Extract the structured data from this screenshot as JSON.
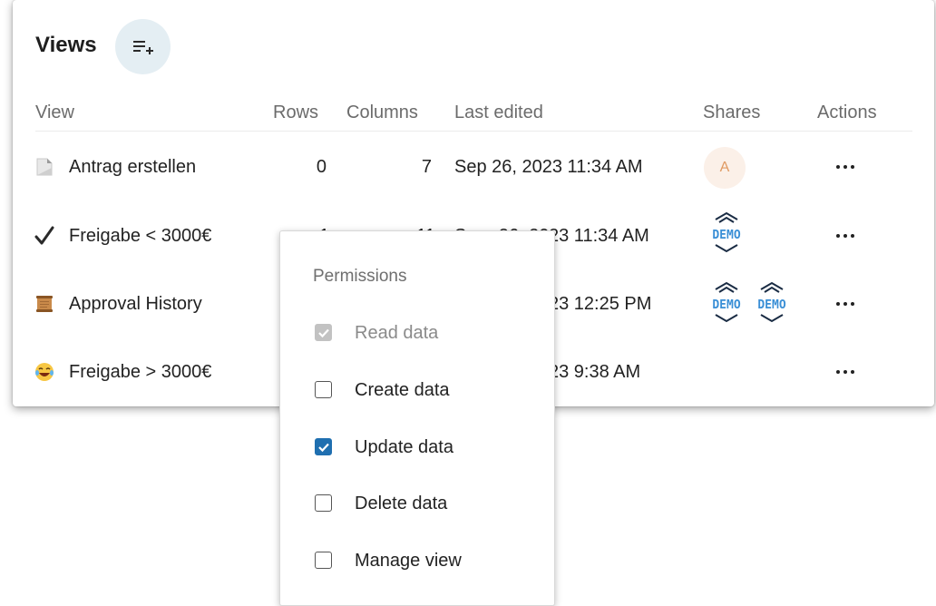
{
  "header": {
    "title": "Views",
    "add_button_icon": "playlist-add-icon"
  },
  "table": {
    "columns": [
      "View",
      "Rows",
      "Columns",
      "Last edited",
      "Shares",
      "Actions"
    ],
    "rows": [
      {
        "emoji": "page-icon",
        "name": "Antrag erstellen",
        "rows": "0",
        "columns": "7",
        "last_edited": "Sep 26, 2023 11:34 AM",
        "shares": [
          "avatar-A"
        ]
      },
      {
        "emoji": "check-mark-icon",
        "name": "Freigabe < 3000€",
        "rows": "1",
        "columns": "11",
        "last_edited": "Sep 26, 2023 11:34 AM",
        "shares": [
          "demo-logo"
        ]
      },
      {
        "emoji": "scroll-icon",
        "name": "Approval History",
        "rows": "",
        "columns": "",
        "last_edited": "23 12:25 PM",
        "shares": [
          "demo-logo",
          "demo-logo"
        ]
      },
      {
        "emoji": "laughing-face-icon",
        "name": "Freigabe > 3000€",
        "rows": "",
        "columns": "",
        "last_edited": "23 9:38 AM",
        "shares": []
      }
    ],
    "row1_partial": {
      "rows": "1",
      "columns": "11",
      "last_edited_visible": "S",
      "last_edited_tail": "23 11:34 AM",
      "last_edited_mid": "ep 26, 20"
    },
    "avatar_initial": "A",
    "demo_text": "DEMO",
    "actions_icon": "more-horizontal-icon"
  },
  "permissions": {
    "title": "Permissions",
    "items": [
      {
        "label": "Read data",
        "checked": true,
        "disabled": true
      },
      {
        "label": "Create data",
        "checked": false,
        "disabled": false
      },
      {
        "label": "Update data",
        "checked": true,
        "disabled": false
      },
      {
        "label": "Delete data",
        "checked": false,
        "disabled": false
      },
      {
        "label": "Manage view",
        "checked": false,
        "disabled": false
      }
    ]
  },
  "colors": {
    "accent": "#1f6fb0",
    "demo_blue": "#3a8fd6",
    "avatar_bg": "#fbf0e8",
    "avatar_fg": "#e09a62",
    "add_button_bg": "#e4eef3"
  }
}
